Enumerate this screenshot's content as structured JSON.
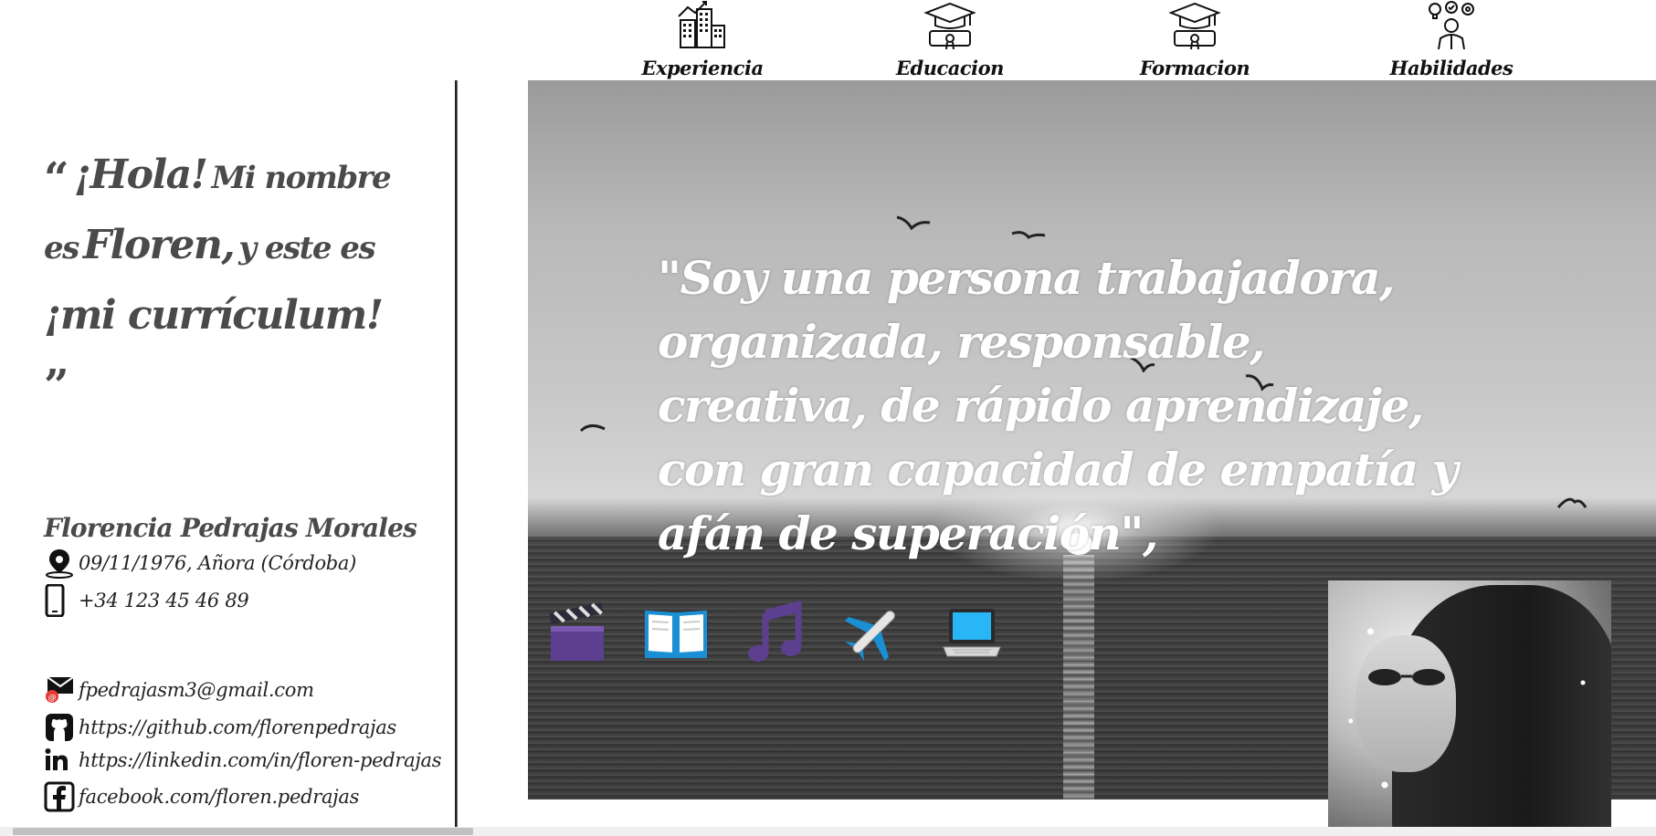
{
  "nav": {
    "items": [
      {
        "label": "Experiencia",
        "icon": "buildings-icon"
      },
      {
        "label": "Educacion",
        "icon": "graduation-cap-icon"
      },
      {
        "label": "Formacion",
        "icon": "graduation-cap-icon"
      },
      {
        "label": "Habilidades",
        "icon": "person-ideas-icon"
      }
    ]
  },
  "sidebar": {
    "quote": {
      "open_mark": "“",
      "part1": "¡Hola!",
      "part2": "Mi nombre es",
      "part3": "Floren,",
      "part4": "y este es",
      "part5": "¡mi currículum!",
      "close_mark": "”"
    },
    "name": "Florencia Pedrajas Morales",
    "birth": "09/11/1976, Añora (Córdoba)",
    "phone": "+34 123 45 46 89",
    "email": "fpedrajasm3@gmail.com",
    "github": "https://github.com/florenpedrajas",
    "linkedin": "https://linkedin.com/in/floren-pedrajas",
    "facebook": "facebook.com/floren.pedrajas"
  },
  "hero": {
    "quote": "\"Soy una persona trabajadora, organizada, responsable, creativa, de rápido aprendizaje, con gran capacidad de empatía y afán de superación\","
  },
  "hobbies": [
    {
      "icon": "clapperboard-icon",
      "emoji": "🎬"
    },
    {
      "icon": "open-book-icon",
      "emoji": "📖"
    },
    {
      "icon": "music-note-icon",
      "emoji": "🎵"
    },
    {
      "icon": "airplane-icon",
      "emoji": "✈️"
    },
    {
      "icon": "laptop-icon",
      "emoji": "💻"
    }
  ],
  "colors": {
    "sidebar_quote": "#4a4a4a",
    "nav_text": "#111111",
    "hero_text": "#ffffff"
  }
}
